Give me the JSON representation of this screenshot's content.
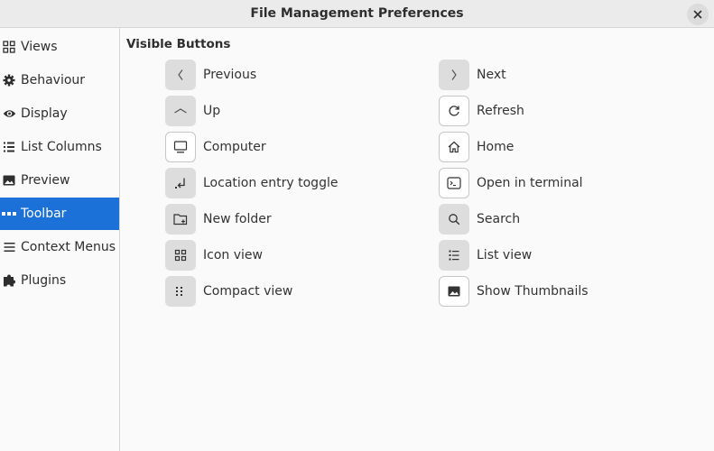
{
  "window": {
    "title": "File Management Preferences"
  },
  "sidebar": {
    "items": [
      {
        "label": "Views",
        "icon": "grid-icon"
      },
      {
        "label": "Behaviour",
        "icon": "gear-icon"
      },
      {
        "label": "Display",
        "icon": "eye-icon"
      },
      {
        "label": "List Columns",
        "icon": "list-columns-icon"
      },
      {
        "label": "Preview",
        "icon": "image-icon"
      },
      {
        "label": "Toolbar",
        "icon": "toolbar-icon",
        "selected": true
      },
      {
        "label": "Context Menus",
        "icon": "menu-icon"
      },
      {
        "label": "Plugins",
        "icon": "puzzle-icon"
      }
    ]
  },
  "main": {
    "section_title": "Visible Buttons",
    "buttons": [
      {
        "label": "Previous",
        "icon": "chevron-left-icon",
        "enabled": false
      },
      {
        "label": "Next",
        "icon": "chevron-right-icon",
        "enabled": false
      },
      {
        "label": "Up",
        "icon": "chevron-up-icon",
        "enabled": false
      },
      {
        "label": "Refresh",
        "icon": "refresh-icon",
        "enabled": true
      },
      {
        "label": "Computer",
        "icon": "computer-icon",
        "enabled": true
      },
      {
        "label": "Home",
        "icon": "home-icon",
        "enabled": true
      },
      {
        "label": "Location entry toggle",
        "icon": "location-entry-icon",
        "enabled": false
      },
      {
        "label": "Open in terminal",
        "icon": "terminal-icon",
        "enabled": true
      },
      {
        "label": "New folder",
        "icon": "new-folder-icon",
        "enabled": false
      },
      {
        "label": "Search",
        "icon": "search-icon",
        "enabled": false
      },
      {
        "label": "Icon view",
        "icon": "icon-view-icon",
        "enabled": false
      },
      {
        "label": "List view",
        "icon": "list-view-icon",
        "enabled": false
      },
      {
        "label": "Compact view",
        "icon": "compact-view-icon",
        "enabled": false
      },
      {
        "label": "Show Thumbnails",
        "icon": "thumbnails-icon",
        "enabled": true
      }
    ]
  },
  "colors": {
    "accent": "#1c71d8",
    "toggle_off_bg": "#dddddd",
    "toggle_on_bg": "#ffffff"
  }
}
